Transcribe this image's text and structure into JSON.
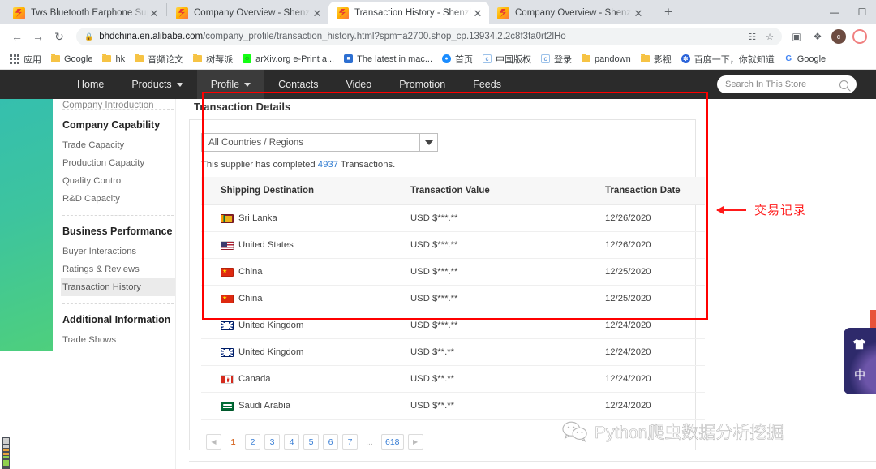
{
  "browser": {
    "tabs": [
      {
        "title": "Tws Bluetooth Earphone Supp",
        "active": false,
        "favicon": "alibaba-favicon",
        "close": "✕"
      },
      {
        "title": "Company Overview - Shenzhe",
        "active": false,
        "favicon": "alibaba-favicon",
        "close": "✕"
      },
      {
        "title": "Transaction History - Shenzhe",
        "active": true,
        "favicon": "alibaba-favicon",
        "close": "✕"
      },
      {
        "title": "Company Overview - Shenzhe",
        "active": false,
        "favicon": "alibaba-favicon",
        "close": "✕"
      }
    ],
    "new_tab_label": "+",
    "window_controls": {
      "minimize": "—",
      "maximize": "☐",
      "close": "✕"
    },
    "nav": {
      "back": "←",
      "forward": "→",
      "reload": "↻"
    },
    "omnibox": {
      "lock_icon": "🔒",
      "host": "bhdchina.en.alibaba.com",
      "path": "/company_profile/transaction_history.html?spm=a2700.shop_cp.13934.2.2c8f3fa0rt2lHo",
      "translate_icon": "translate-icon",
      "bookmark_star": "☆"
    },
    "toolbar_icons": [
      {
        "name": "reading-list-icon",
        "glyph": "▣"
      },
      {
        "name": "extensions-puzzle-icon",
        "glyph": "❖"
      },
      {
        "name": "profile-avatar",
        "glyph": "c"
      },
      {
        "name": "second-profile-avatar",
        "glyph": ""
      }
    ],
    "bookmarks": [
      {
        "label": "应用",
        "icon": "apps-grid-icon"
      },
      {
        "label": "Google",
        "icon": "folder-icon"
      },
      {
        "label": "hk",
        "icon": "folder-icon"
      },
      {
        "label": "音频论文",
        "icon": "folder-icon"
      },
      {
        "label": "树莓派",
        "icon": "folder-icon"
      },
      {
        "label": "arXiv.org e-Print a...",
        "icon": "arxiv-icon"
      },
      {
        "label": "The latest in mac...",
        "icon": "news-icon"
      },
      {
        "label": "首页",
        "icon": "blue-circle-icon"
      },
      {
        "label": "中国版权",
        "icon": "copyright-icon"
      },
      {
        "label": "登录",
        "icon": "copyright-icon"
      },
      {
        "label": "pandown",
        "icon": "folder-icon"
      },
      {
        "label": "影视",
        "icon": "folder-icon"
      },
      {
        "label": "百度一下，你就知道",
        "icon": "baidu-icon"
      },
      {
        "label": "Google",
        "icon": "google-g-icon"
      }
    ]
  },
  "store_nav": {
    "items": [
      {
        "label": "Home",
        "has_caret": false,
        "active": false
      },
      {
        "label": "Products",
        "has_caret": true,
        "active": false
      },
      {
        "label": "Profile",
        "has_caret": true,
        "active": true
      },
      {
        "label": "Contacts",
        "has_caret": false,
        "active": false
      },
      {
        "label": "Video",
        "has_caret": false,
        "active": false
      },
      {
        "label": "Promotion",
        "has_caret": false,
        "active": false
      },
      {
        "label": "Feeds",
        "has_caret": false,
        "active": false
      }
    ],
    "search_placeholder": "Search In This Store"
  },
  "sidebar": {
    "cut_off_item": "Company Introduction",
    "groups": [
      {
        "title": "Company Capability",
        "items": [
          {
            "label": "Trade Capacity",
            "selected": false
          },
          {
            "label": "Production Capacity",
            "selected": false
          },
          {
            "label": "Quality Control",
            "selected": false
          },
          {
            "label": "R&D Capacity",
            "selected": false
          }
        ]
      },
      {
        "title": "Business Performance",
        "items": [
          {
            "label": "Buyer Interactions",
            "selected": false
          },
          {
            "label": "Ratings & Reviews",
            "selected": false
          },
          {
            "label": "Transaction History",
            "selected": true
          }
        ]
      },
      {
        "title": "Additional Information",
        "items": [
          {
            "label": "Trade Shows",
            "selected": false
          }
        ]
      }
    ]
  },
  "main": {
    "page_title": "Transaction Details",
    "filter": {
      "value": "All Countries / Regions",
      "arrow": "▼"
    },
    "summary": {
      "prefix": "This supplier has completed ",
      "count": "4937",
      "suffix": " Transactions."
    },
    "table": {
      "headers": [
        "Shipping Destination",
        "Transaction Value",
        "Transaction Date"
      ],
      "rows": [
        {
          "flag": "lk",
          "destination": "Sri Lanka",
          "value": "USD $***.**",
          "date": "12/26/2020"
        },
        {
          "flag": "us",
          "destination": "United States",
          "value": "USD $***.**",
          "date": "12/26/2020"
        },
        {
          "flag": "cn",
          "destination": "China",
          "value": "USD $***.**",
          "date": "12/25/2020"
        },
        {
          "flag": "cn",
          "destination": "China",
          "value": "USD $***.**",
          "date": "12/25/2020"
        },
        {
          "flag": "gb",
          "destination": "United Kingdom",
          "value": "USD $***.**",
          "date": "12/24/2020"
        },
        {
          "flag": "gb",
          "destination": "United Kingdom",
          "value": "USD $**.**",
          "date": "12/24/2020"
        },
        {
          "flag": "ca",
          "destination": "Canada",
          "value": "USD $**.**",
          "date": "12/24/2020"
        },
        {
          "flag": "sa",
          "destination": "Saudi Arabia",
          "value": "USD $**.**",
          "date": "12/24/2020"
        }
      ]
    },
    "pagination": {
      "prev": "◀",
      "next": "▶",
      "pages": [
        "1",
        "2",
        "3",
        "4",
        "5",
        "6",
        "7"
      ],
      "ellipsis": "...",
      "last": "618",
      "current": "1"
    }
  },
  "annotation": {
    "text": "交易记录",
    "arrow": "←",
    "color": "#ff1a1a",
    "box_color": "#ff0000"
  },
  "floating_widget": {
    "icon": "shirt-icon",
    "label": "中"
  },
  "watermark": {
    "text": "Python爬虫数据分析挖掘",
    "icon": "wechat-icon"
  }
}
